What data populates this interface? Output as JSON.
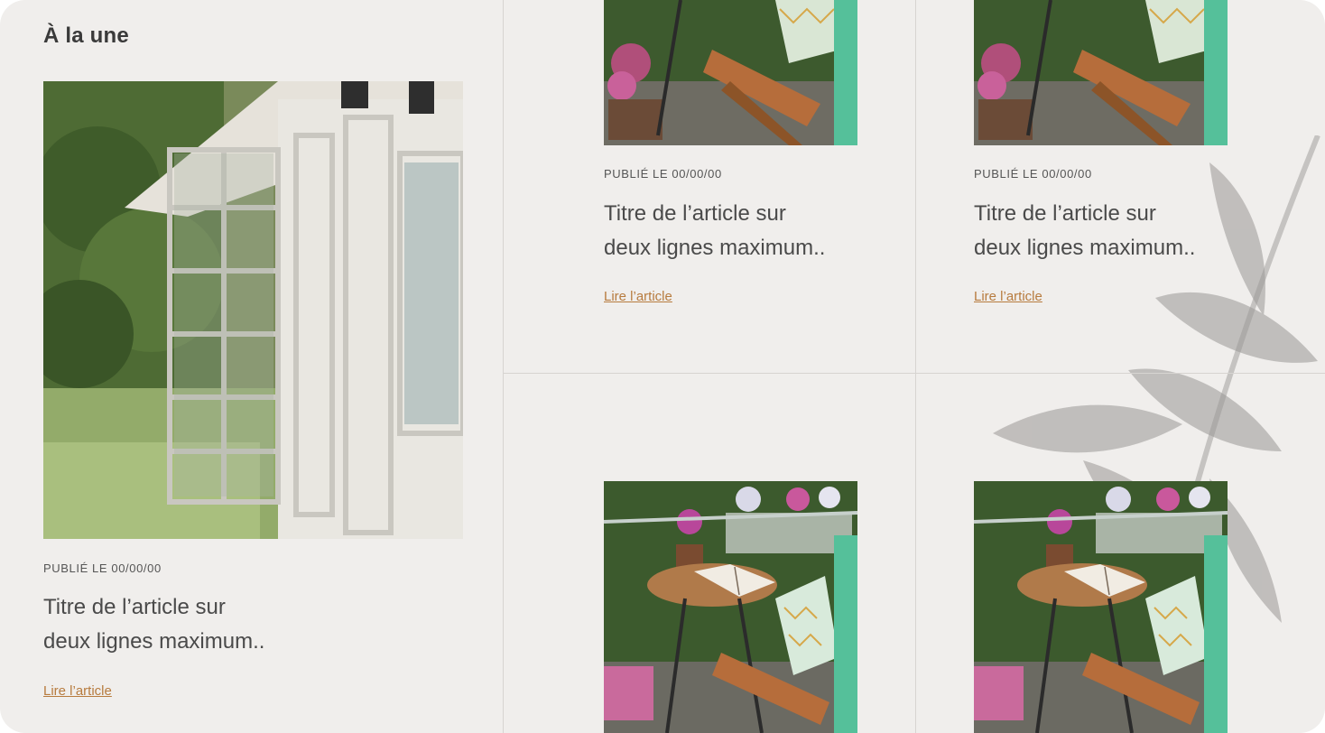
{
  "section": {
    "title": "À la une"
  },
  "featured": {
    "date": "PUBLIÉ LE 00/00/00",
    "title_line1": "Titre de l’article sur",
    "title_line2": "deux lignes maximum..",
    "link": "Lire l’article"
  },
  "cards": [
    {
      "date": "PUBLIÉ LE 00/00/00",
      "title_line1": "Titre de l’article sur",
      "title_line2": "deux lignes maximum..",
      "link": "Lire l’article"
    },
    {
      "date": "PUBLIÉ LE 00/00/00",
      "title_line1": "Titre de l’article sur",
      "title_line2": "deux lignes maximum..",
      "link": "Lire l’article"
    }
  ],
  "colors": {
    "background": "#f0eeec",
    "link": "#b77b3e",
    "text": "#4a4a4a"
  }
}
